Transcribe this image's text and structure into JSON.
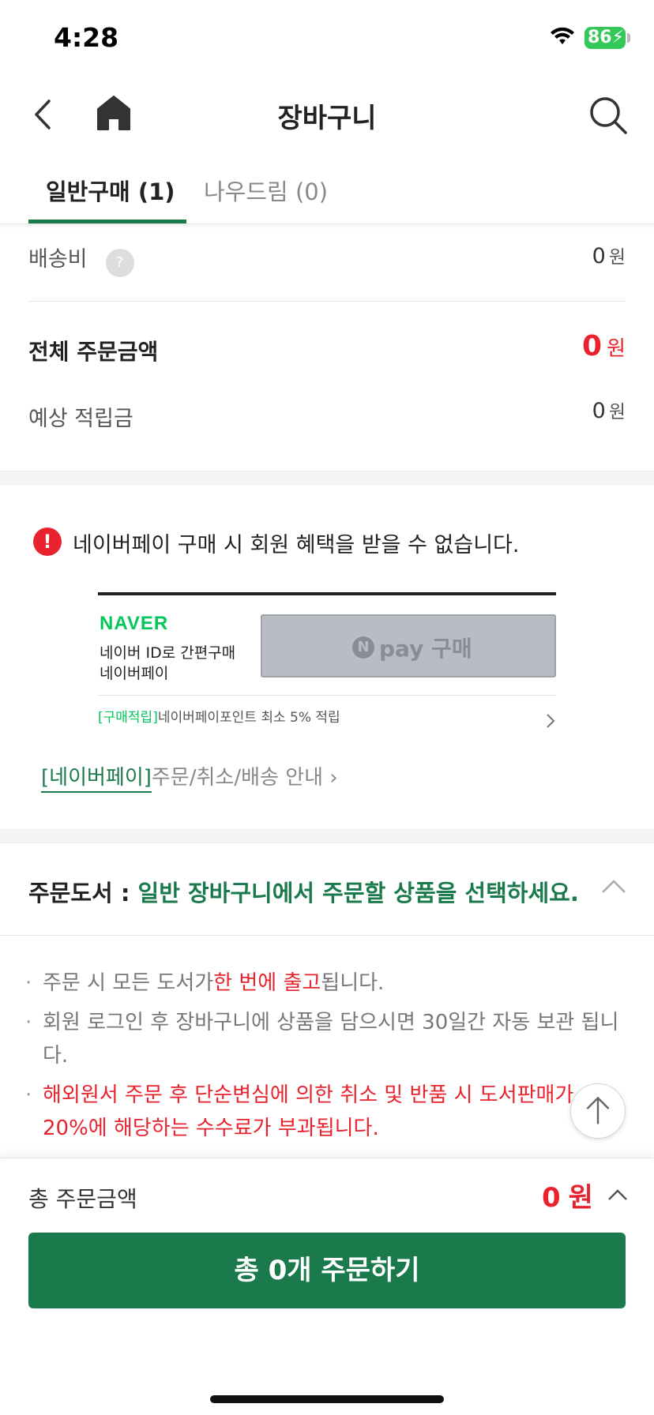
{
  "status_bar": {
    "time": "4:28",
    "battery": "86"
  },
  "header": {
    "title": "장바구니"
  },
  "tabs": [
    {
      "label": "일반구매 (1)"
    },
    {
      "label": "나우드림 (0)"
    }
  ],
  "summary": {
    "shipping_label": "배송비",
    "shipping_help": "?",
    "shipping_value": "0",
    "unit": "원",
    "total_label": "전체 주문금액",
    "total_value": "0",
    "points_label": "예상 적립금",
    "points_value": "0"
  },
  "naverpay": {
    "notice": "네이버페이 구매 시 회원 혜택을 받을 수 없습니다.",
    "logo": "NAVER",
    "sub1": "네이버 ID로 간편구매",
    "sub2": "네이버페이",
    "button_n": "N",
    "button_label": "pay 구매",
    "point_tag": "[구매적립]",
    "point_text": "네이버페이포인트 최소 5% 적립",
    "guide_tag": "[네이버페이]",
    "guide_text": "주문/취소/배송 안내 ›"
  },
  "order": {
    "title_prefix": "주문도서 : ",
    "title_green": "일반 장바구니에서 주문할 상품을 선택하세요.",
    "bullet1_a": "주문 시 모든 도서가",
    "bullet1_red": "한 번에 출고",
    "bullet1_b": "됩니다.",
    "bullet2": "회원 로그인 후 장바구니에 상품을 담으시면 30일간 자동 보관 됩니다.",
    "bullet3": "해외원서 주문 후 단순변심에 의한 취소 및 반품 시 도서판매가 20%에 해당하는 수수료가 부과됩니다."
  },
  "bottom": {
    "total_label": "총 주문금액",
    "total_value": "0",
    "unit": "원",
    "order_button": "총 0개 주문하기"
  },
  "colors": {
    "accent": "#1b7a4c",
    "price_red": "#e8232e",
    "naver_green": "#03c75a"
  },
  "icons": [
    "wifi-icon",
    "back-icon",
    "home-icon",
    "search-icon",
    "help-icon",
    "alert-icon",
    "chevron-right-icon",
    "chevron-up-icon",
    "arrow-up-icon"
  ]
}
